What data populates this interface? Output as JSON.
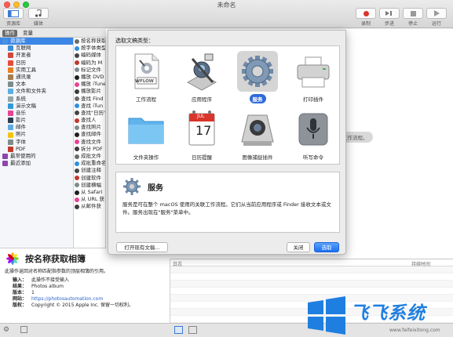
{
  "window": {
    "title": "未命名"
  },
  "toolbar": {
    "left": [
      {
        "label": "资源库",
        "icon": "library-icon"
      },
      {
        "label": "媒体",
        "icon": "media-icon"
      }
    ],
    "right": [
      {
        "label": "录制",
        "icon": "record-icon"
      },
      {
        "label": "步进",
        "icon": "step-icon"
      },
      {
        "label": "停止",
        "icon": "stop-icon"
      },
      {
        "label": "运行",
        "icon": "run-icon"
      }
    ]
  },
  "library_tabs": {
    "actions": "操作",
    "variables": "变量"
  },
  "library": {
    "items": [
      {
        "label": "资源库",
        "color": "#4a90e2",
        "selected": true
      },
      {
        "label": "互联网",
        "color": "#3a8fd9"
      },
      {
        "label": "开发者",
        "color": "#d04a3b"
      },
      {
        "label": "日历",
        "color": "#e74c3c"
      },
      {
        "label": "实用工具",
        "color": "#e67e22"
      },
      {
        "label": "通讯录",
        "color": "#a67c52"
      },
      {
        "label": "文本",
        "color": "#7f8c8d"
      },
      {
        "label": "文件和文件夹",
        "color": "#5dade2"
      },
      {
        "label": "系统",
        "color": "#95a5a6"
      },
      {
        "label": "演示文稿",
        "color": "#3498db"
      },
      {
        "label": "音乐",
        "color": "#e84393"
      },
      {
        "label": "影片",
        "color": "#2c3e50"
      },
      {
        "label": "邮件",
        "color": "#5dade2"
      },
      {
        "label": "照片",
        "color": "#f1c40f"
      },
      {
        "label": "字体",
        "color": "#7f8c8d"
      },
      {
        "label": "PDF",
        "color": "#c0392b"
      },
      {
        "label": "最常使用的",
        "color": "#8e44ad"
      },
      {
        "label": "最近添加",
        "color": "#8e44ad"
      }
    ]
  },
  "actions": {
    "items": [
      "按名称获取",
      "按字体类型",
      "编码媒体",
      "编码为 M",
      "标记文件",
      "播放 DVD",
      "播放 iTunes",
      "播放影片",
      "查找 Find",
      "查找 iTun",
      "查找\"日历\"",
      "查找人",
      "查找照片",
      "查找邮件",
      "查找文件",
      "拆分 PDF",
      "成批文件",
      "成批重命名",
      "创建注释",
      "创建软件",
      "创建横幅",
      "从 Safari",
      "从 URL 获",
      "从邮件获"
    ]
  },
  "description": {
    "title": "按名称获取相簿",
    "body": "此操作返回对名称匹配指参数的顶层相簿的引用。",
    "rows": [
      {
        "k": "输入：",
        "v": "此操作不接受输入"
      },
      {
        "k": "结果：",
        "v": "Photos album"
      },
      {
        "k": "版本：",
        "v": "1"
      },
      {
        "k": "网站：",
        "v": "https://photosautomation.com"
      },
      {
        "k": "版权：",
        "v": "Copyright © 2015 Apple Inc. 保留一切权利。"
      }
    ]
  },
  "workarea": {
    "drop_hint": "工作流程。"
  },
  "log": {
    "col1": "日志",
    "col2": "持续时间"
  },
  "sheet": {
    "title": "选取文稿类型：",
    "types": [
      {
        "label": "工作流程",
        "icon": "workflow-icon",
        "selected": false
      },
      {
        "label": "应用程序",
        "icon": "application-icon",
        "selected": false
      },
      {
        "label": "服务",
        "icon": "service-gear-icon",
        "selected": true
      },
      {
        "label": "打印插件",
        "icon": "printer-icon",
        "selected": false
      },
      {
        "label": "文件夹操作",
        "icon": "folder-icon",
        "selected": false
      },
      {
        "label": "日历提醒",
        "icon": "calendar-icon",
        "selected": false
      },
      {
        "label": "图像捕捉插件",
        "icon": "camera-icon",
        "selected": false
      },
      {
        "label": "听写命令",
        "icon": "microphone-icon",
        "selected": false
      }
    ],
    "workflow_badge": "WFLOW",
    "calendar_month": "JUL",
    "calendar_day": "17",
    "info_title": "服务",
    "info_body": "服务是可在整个 macOS 使用的关联工作流程。它们从当前应用程序或 Finder 接收文本或文件。服务出现在\"服务\"菜单中。",
    "open_existing": "打开现有文稿...",
    "close": "关闭",
    "choose": "选取"
  },
  "watermark": {
    "text": "飞飞系统",
    "url": "www.feifeixitong.com"
  }
}
